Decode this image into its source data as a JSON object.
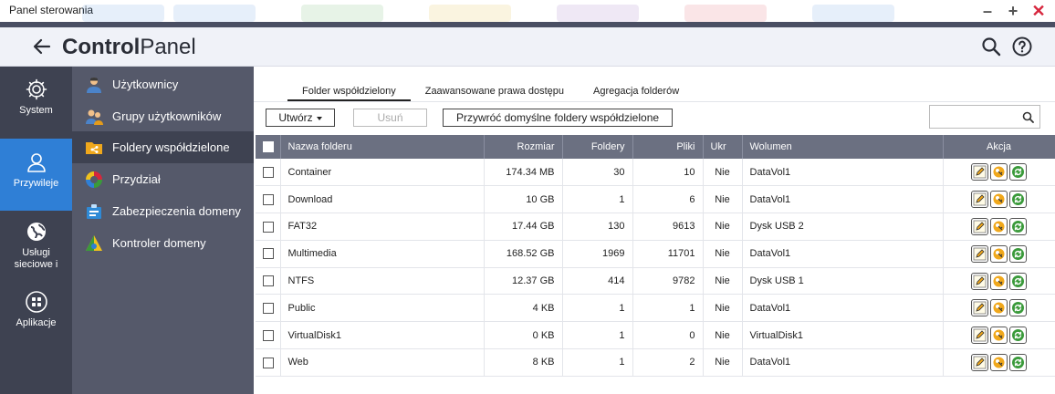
{
  "window": {
    "title": "Panel sterowania"
  },
  "header": {
    "title_bold": "Control",
    "title_light": "Panel"
  },
  "leftnav": [
    {
      "label": "System",
      "icon": "gear-icon",
      "active": false
    },
    {
      "label": "Przywileje",
      "icon": "user-icon",
      "active": true
    },
    {
      "label": "Usługi sieciowe i",
      "icon": "globe-icon",
      "active": false
    },
    {
      "label": "Aplikacje",
      "icon": "apps-icon",
      "active": false
    }
  ],
  "subnav": [
    {
      "label": "Użytkownicy",
      "icon": "user-icon"
    },
    {
      "label": "Grupy użytkowników",
      "icon": "user-group-icon"
    },
    {
      "label": "Foldery współdzielone",
      "icon": "shared-folder-icon",
      "active": true
    },
    {
      "label": "Przydział",
      "icon": "quota-icon"
    },
    {
      "label": "Zabezpieczenia domeny",
      "icon": "domain-security-icon"
    },
    {
      "label": "Kontroler domeny",
      "icon": "domain-controller-icon"
    }
  ],
  "tabs": [
    {
      "label": "Folder współdzielony",
      "active": true
    },
    {
      "label": "Zaawansowane prawa dostępu"
    },
    {
      "label": "Agregacja folderów"
    }
  ],
  "toolbar": {
    "create_label": "Utwórz",
    "delete_label": "Usuń",
    "restore_label": "Przywróć domyślne foldery współdzielone",
    "search_placeholder": ""
  },
  "table": {
    "columns": [
      "Nazwa folderu",
      "Rozmiar",
      "Foldery",
      "Pliki",
      "Ukr",
      "Wolumen",
      "Akcja"
    ],
    "rows": [
      {
        "name": "Container",
        "size": "174.34 MB",
        "folders": "30",
        "files": "10",
        "hidden": "Nie",
        "volume": "DataVol1"
      },
      {
        "name": "Download",
        "size": "10 GB",
        "folders": "1",
        "files": "6",
        "hidden": "Nie",
        "volume": "DataVol1"
      },
      {
        "name": "FAT32",
        "size": "17.44 GB",
        "folders": "130",
        "files": "9613",
        "hidden": "Nie",
        "volume": "Dysk USB 2"
      },
      {
        "name": "Multimedia",
        "size": "168.52 GB",
        "folders": "1969",
        "files": "11701",
        "hidden": "Nie",
        "volume": "DataVol1"
      },
      {
        "name": "NTFS",
        "size": "12.37 GB",
        "folders": "414",
        "files": "9782",
        "hidden": "Nie",
        "volume": "Dysk USB 1"
      },
      {
        "name": "Public",
        "size": "4 KB",
        "folders": "1",
        "files": "1",
        "hidden": "Nie",
        "volume": "DataVol1"
      },
      {
        "name": "VirtualDisk1",
        "size": "0 KB",
        "folders": "1",
        "files": "0",
        "hidden": "Nie",
        "volume": "VirtualDisk1"
      },
      {
        "name": "Web",
        "size": "8 KB",
        "folders": "1",
        "files": "2",
        "hidden": "Nie",
        "volume": "DataVol1"
      }
    ]
  },
  "colors": {
    "accent": "#2f7fd6",
    "nav_bg": "#3e4251",
    "subnav_bg": "#55596a",
    "table_header": "#6b7081"
  }
}
